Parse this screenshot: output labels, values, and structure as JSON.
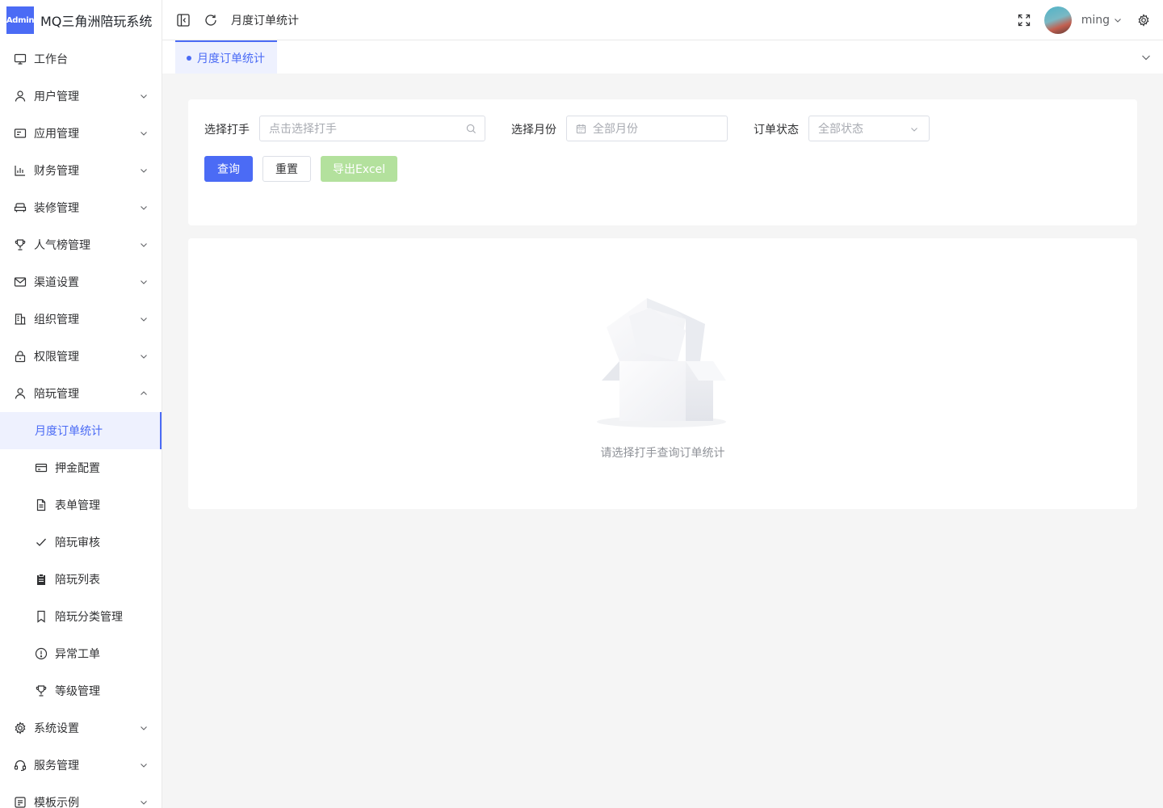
{
  "app": {
    "logo_badge": "Admin",
    "title": "MQ三角洲陪玩系统"
  },
  "sidebar": {
    "items": [
      {
        "label": "工作台",
        "icon": "monitor-icon",
        "expandable": false
      },
      {
        "label": "用户管理",
        "icon": "user-icon",
        "expandable": true
      },
      {
        "label": "应用管理",
        "icon": "app-window-icon",
        "expandable": true
      },
      {
        "label": "财务管理",
        "icon": "bar-chart-icon",
        "expandable": true
      },
      {
        "label": "装修管理",
        "icon": "sofa-icon",
        "expandable": true
      },
      {
        "label": "人气榜管理",
        "icon": "trophy-icon",
        "expandable": true
      },
      {
        "label": "渠道设置",
        "icon": "mail-icon",
        "expandable": true
      },
      {
        "label": "组织管理",
        "icon": "building-icon",
        "expandable": true
      },
      {
        "label": "权限管理",
        "icon": "lock-icon",
        "expandable": true
      },
      {
        "label": "陪玩管理",
        "icon": "user-icon",
        "expandable": true,
        "expanded": true
      }
    ],
    "companion_children": [
      {
        "label": "月度订单统计",
        "icon": "",
        "active": true
      },
      {
        "label": "押金配置",
        "icon": "credit-card-icon"
      },
      {
        "label": "表单管理",
        "icon": "document-icon"
      },
      {
        "label": "陪玩审核",
        "icon": "check-icon"
      },
      {
        "label": "陪玩列表",
        "icon": "clipboard-icon"
      },
      {
        "label": "陪玩分类管理",
        "icon": "bookmark-icon"
      },
      {
        "label": "异常工单",
        "icon": "warning-circle-icon"
      },
      {
        "label": "等级管理",
        "icon": "trophy-icon"
      }
    ],
    "bottom_items": [
      {
        "label": "系统设置",
        "icon": "gear-icon",
        "expandable": true
      },
      {
        "label": "服务管理",
        "icon": "headset-icon",
        "expandable": true
      },
      {
        "label": "模板示例",
        "icon": "template-icon",
        "expandable": true
      }
    ]
  },
  "header": {
    "breadcrumb": "月度订单统计",
    "username": "ming"
  },
  "tabs": [
    {
      "label": "月度订单统计",
      "active": true
    }
  ],
  "filters": {
    "player_label": "选择打手",
    "player_placeholder": "点击选择打手",
    "month_label": "选择月份",
    "month_placeholder": "全部月份",
    "status_label": "订单状态",
    "status_placeholder": "全部状态",
    "query_button": "查询",
    "reset_button": "重置",
    "export_button": "导出Excel"
  },
  "result": {
    "empty_text": "请选择打手查询订单统计"
  },
  "colors": {
    "primary": "#4b6bf5",
    "success_disabled": "#b3e19d"
  }
}
